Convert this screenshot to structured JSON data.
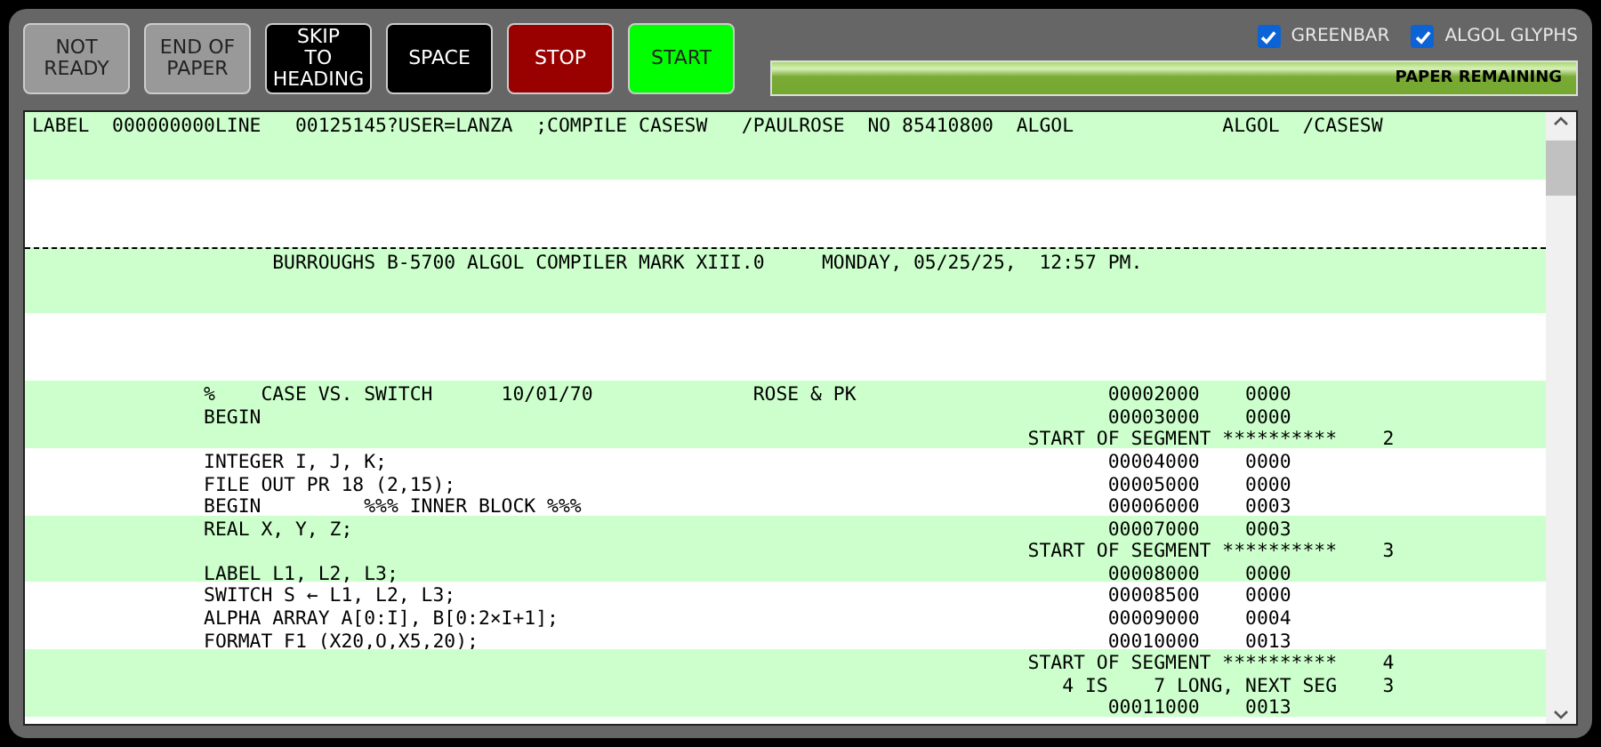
{
  "buttons": [
    {
      "label": "NOT\nREADY",
      "color": "#999999"
    },
    {
      "label": "END OF\nPAPER",
      "color": "#999999"
    },
    {
      "label": "SKIP\nTO\nHEADING",
      "color": "#000000"
    },
    {
      "label": "SPACE",
      "color": "#000000"
    },
    {
      "label": "STOP",
      "color": "#990000"
    },
    {
      "label": "START",
      "color": "#00ff00"
    }
  ],
  "options": [
    {
      "label": "GREENBAR",
      "checked": true
    },
    {
      "label": "ALGOL GLYPHS",
      "checked": true
    }
  ],
  "paper_remaining": {
    "label": "PAPER REMAINING",
    "level": 1
  },
  "printout": {
    "lines": [
      {
        "kind": "text",
        "text": "LABEL  000000000LINE   00125145?USER=LANZA  ;COMPILE CASESW   /PAULROSE  NO 85410800  ALGOL             ALGOL  /CASESW"
      },
      {
        "kind": "blank"
      },
      {
        "kind": "blank"
      },
      {
        "kind": "blank"
      },
      {
        "kind": "blank"
      },
      {
        "kind": "blank"
      },
      {
        "kind": "page_break",
        "text": "                     BURROUGHS B-5700 ALGOL COMPILER MARK XIII.0     MONDAY, 05/25/25,  12:57 PM."
      },
      {
        "kind": "blank"
      },
      {
        "kind": "blank"
      },
      {
        "kind": "blank"
      },
      {
        "kind": "blank"
      },
      {
        "kind": "blank"
      },
      {
        "kind": "text",
        "text": "               %    CASE VS. SWITCH      10/01/70              ROSE & PK                      00002000    0000"
      },
      {
        "kind": "text",
        "text": "               BEGIN                                                                          00003000    0000"
      },
      {
        "kind": "text",
        "text": "                                                                                       START OF SEGMENT **********    2"
      },
      {
        "kind": "text",
        "text": "               INTEGER I, J, K;                                                               00004000    0000"
      },
      {
        "kind": "text",
        "text": "               FILE OUT PR 18 (2,15);                                                         00005000    0000"
      },
      {
        "kind": "text",
        "text": "               BEGIN         %%% INNER BLOCK %%%                                              00006000    0003"
      },
      {
        "kind": "text",
        "text": "               REAL X, Y, Z;                                                                  00007000    0003"
      },
      {
        "kind": "text",
        "text": "                                                                                       START OF SEGMENT **********    3"
      },
      {
        "kind": "text",
        "text": "               LABEL L1, L2, L3;                                                              00008000    0000"
      },
      {
        "kind": "text",
        "text": "               SWITCH S ← L1, L2, L3;                                                         00008500    0000"
      },
      {
        "kind": "text",
        "text": "               ALPHA ARRAY A[0:I], B[0:2×I+1];                                                00009000    0004"
      },
      {
        "kind": "text",
        "text": "               FORMAT F1 (X20,O,X5,20);                                                       00010000    0013"
      },
      {
        "kind": "text",
        "text": "                                                                                       START OF SEGMENT **********    4"
      },
      {
        "kind": "text",
        "text": "                                                                                          4 IS    7 LONG, NEXT SEG    3"
      },
      {
        "kind": "text",
        "text": "                                                                                              00011000    0013"
      }
    ]
  }
}
